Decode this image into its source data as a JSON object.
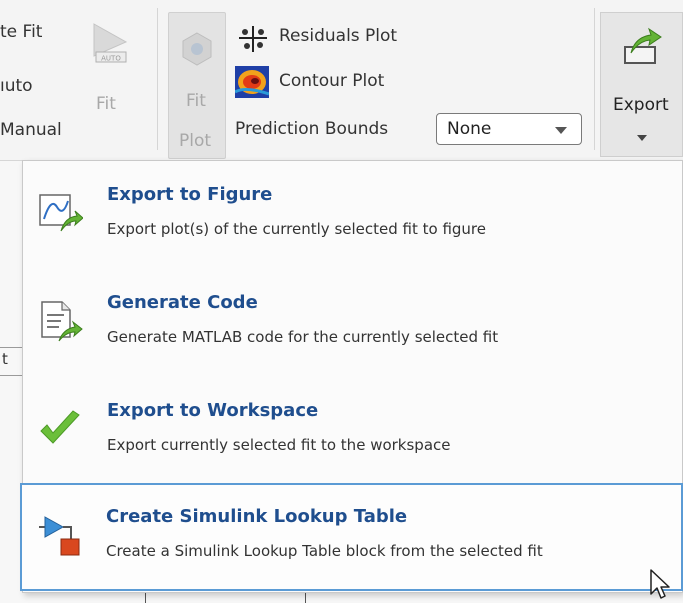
{
  "toolstrip": {
    "left_labels": [
      "te Fit",
      "ıuto",
      "Manual"
    ],
    "fit_label": "Fit",
    "fit_plot_label_1": "Fit",
    "fit_plot_label_2": "Plot",
    "residuals_plot": "Residuals Plot",
    "contour_plot": "Contour Plot",
    "prediction_bounds_label": "Prediction Bounds",
    "prediction_bounds_value": "None",
    "export_label": "Export",
    "auto_badge": "AUTO"
  },
  "background": {
    "fragment": "t"
  },
  "menu": {
    "items": [
      {
        "title": "Export to Figure",
        "desc": "Export plot(s) of the currently selected fit to figure",
        "icon": "export-figure-icon"
      },
      {
        "title": "Generate Code",
        "desc": "Generate MATLAB code for the currently selected fit",
        "icon": "generate-code-icon"
      },
      {
        "title": "Export to Workspace",
        "desc": "Export currently selected fit to the workspace",
        "icon": "checkmark-icon"
      },
      {
        "title": "Create Simulink Lookup Table",
        "desc": "Create a Simulink Lookup Table block from the selected fit",
        "icon": "simulink-block-icon"
      }
    ],
    "highlighted_index": 3
  },
  "colors": {
    "title_blue": "#1f4e8e",
    "highlight_border": "#5b9bd5",
    "check_green": "#6bbf3a"
  }
}
